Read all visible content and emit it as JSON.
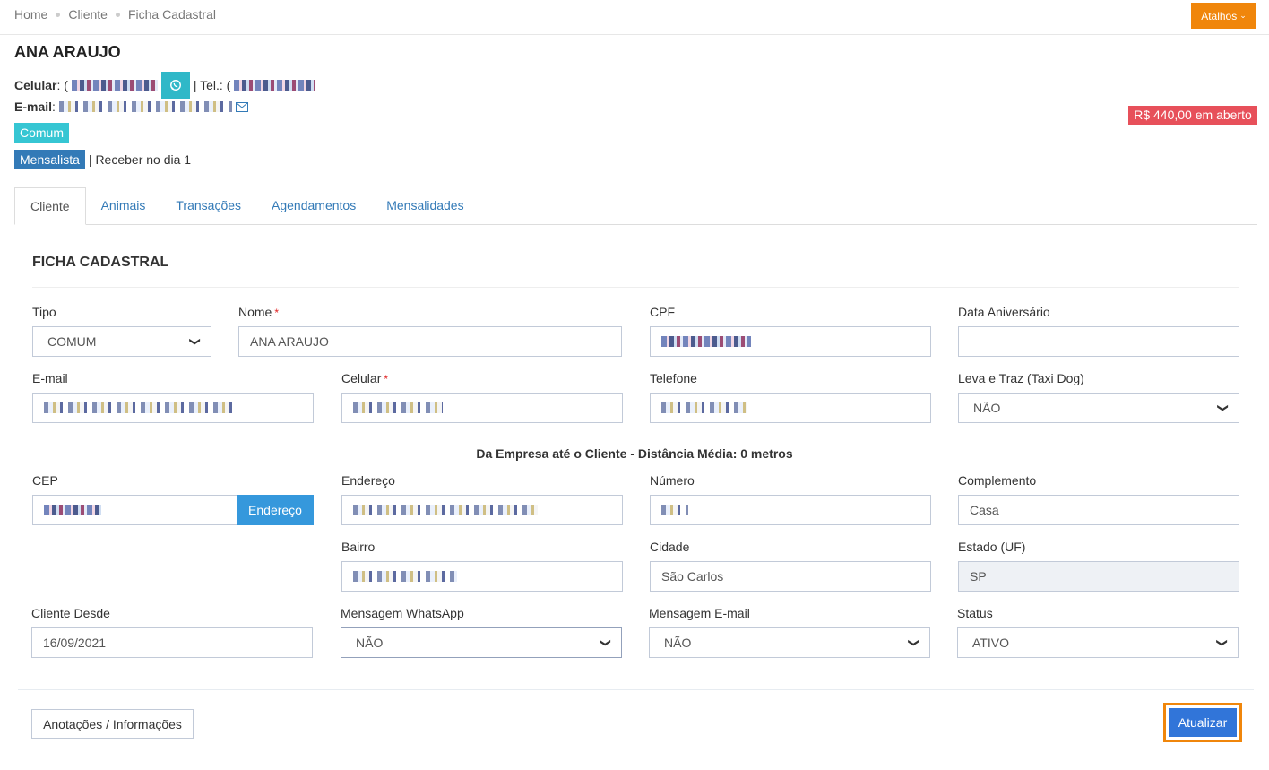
{
  "breadcrumb": [
    "Home",
    "Cliente",
    "Ficha Cadastral"
  ],
  "shortcuts_label": "Atalhos",
  "client": {
    "name": "ANA ARAUJO",
    "celular_label": "Celular",
    "tel_label": "| Tel.:",
    "email_label": "E-mail",
    "type_badge": "Comum",
    "plan_badge": "Mensalista",
    "plan_note": "| Receber no dia 1",
    "open_balance": "R$ 440,00 em aberto"
  },
  "tabs": [
    "Cliente",
    "Animais",
    "Transações",
    "Agendamentos",
    "Mensalidades"
  ],
  "form": {
    "section_title": "FICHA CADASTRAL",
    "tipo": {
      "label": "Tipo",
      "value": "COMUM"
    },
    "nome": {
      "label": "Nome",
      "value": "ANA ARAUJO"
    },
    "cpf": {
      "label": "CPF"
    },
    "aniversario": {
      "label": "Data Aniversário",
      "value": ""
    },
    "email": {
      "label": "E-mail"
    },
    "celular": {
      "label": "Celular"
    },
    "telefone": {
      "label": "Telefone"
    },
    "taxi_dog": {
      "label": "Leva e Traz (Taxi Dog)",
      "value": "NÃO"
    },
    "distance_text": "Da Empresa até o Cliente - Distância Média: 0 metros",
    "cep": {
      "label": "CEP",
      "button": "Endereço"
    },
    "endereco": {
      "label": "Endereço"
    },
    "numero": {
      "label": "Número"
    },
    "complemento": {
      "label": "Complemento",
      "value": "Casa"
    },
    "bairro": {
      "label": "Bairro"
    },
    "cidade": {
      "label": "Cidade",
      "value": "São Carlos"
    },
    "estado": {
      "label": "Estado (UF)",
      "value": "SP"
    },
    "cliente_desde": {
      "label": "Cliente Desde",
      "value": "16/09/2021"
    },
    "msg_whatsapp": {
      "label": "Mensagem WhatsApp",
      "value": "NÃO"
    },
    "msg_email": {
      "label": "Mensagem E-mail",
      "value": "NÃO"
    },
    "status": {
      "label": "Status",
      "value": "ATIVO"
    }
  },
  "actions": {
    "notes_button": "Anotações / Informações",
    "update_button": "Atualizar"
  },
  "icons": [
    "whatsapp-icon",
    "envelope-icon",
    "chevron-down-icon"
  ],
  "colors": {
    "accent_orange": "#f0860b",
    "badge_cyan": "#36c6d3",
    "badge_blue": "#337ab7",
    "balance_red": "#e7505a",
    "primary_button": "#3175d9"
  }
}
